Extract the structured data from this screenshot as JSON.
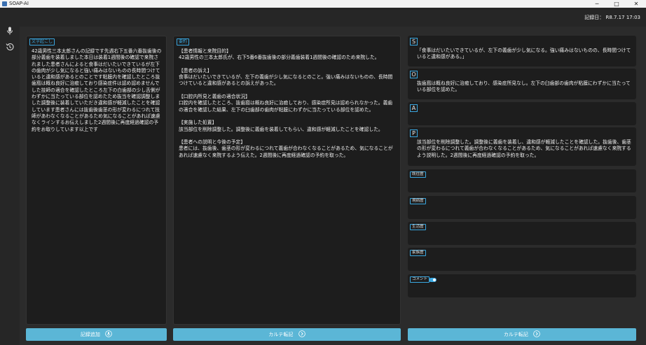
{
  "window": {
    "title": "SOAP-AI",
    "minimize": "─",
    "maximize": "□",
    "close": "✕"
  },
  "header": {
    "record_date": "記録日： R8.7.17 17:03"
  },
  "transcript": {
    "label": "文字起こし",
    "text": "42歳男性三本太郎さんの記録です先週右下五番六番抜歯後の部分義歯を装着しました本日は装着1週間後の確認で来院されました患者さんによると食事はだいたいできているが左下の歯肉が少し気になると強い痛みはないものの長時間つけていると違和感があるとのことです粘膜内を確認したところ抜歯窩は概ね良好に治癒しており感染症件は認め認めませんでした技師の適合を確認したところ左下の白歯部の少し舌側がわずかに当たっている部位を認めたため抜当を確認調整しました調整後に装着していただき違和感が軽減したことを確認しています患者さんには抜歯後歯茎の形が変わるにつれて技師があわなくなることがあるため気になることがあれば速慮なくラインするお伝えしました2週間後に再度経過確認の予約をお取りしています以上です"
  },
  "summary": {
    "label": "要約",
    "text": "【患者情報と来院目的】\n42歳男性の三本太郎氏が、右下5番6番抜歯後の部分義歯装着1週間後の確認のため来院した。\n\n【患者の訴え】\n食事はだいたいできているが、左下の義歯が少し気になるとのこと。強い痛みはないものの、長時間つけていると違和感があるとの訴えがあった。\n\n【口腔内所見と義歯の適合状況】\n口腔内を確認したところ、抜歯窩は概ね良好に治癒しており、感染症所見は認められなかった。義歯の適合を確認した結果、左下の臼歯部の歯肉が粘膜にわずかに当たっている部位を認めた。\n\n【実施した処置】\n該当部位を削除調整した。調整後に義歯を装着してもらい、違和感が軽減したことを確認した。\n\n【患者への説明と今後の予定】\n患者には、抜歯後、歯茎の形が変わるにつれて義歯が合わなくなることがあるため、気になることがあれば速慮なく来院するよう伝えた。2週間後に再度経過確認の予約を取った。"
  },
  "soap": {
    "s": {
      "letter": "S",
      "text": "「食事はだいたいできているが、左下の義歯が少し気になる。強い痛みはないものの、長時間つけていると違和感がある。」"
    },
    "o": {
      "letter": "O",
      "text": "抜歯窩は概ね良好に治癒しており、感染症所見なし。左下の臼歯部の歯肉が粘膜にわずかに当たっている部位を認めた。"
    },
    "a": {
      "letter": "A",
      "text": ""
    },
    "p": {
      "letter": "P",
      "text": "該当部位を削除調整した。調整後に義歯を装着し、違和感が軽減したことを確認した。抜歯後、歯茎の形が変わるにつれて義歯が合わなくなることがあるため、気になることがあれば速慮なく来院するよう説明した。2週間後に再度経過確認の予約を取った。"
    }
  },
  "history": {
    "past_history": "既往歴",
    "present_illness": "現病歴",
    "lifestyle": "生活歴",
    "family_history": "家族歴",
    "comment": "コメント",
    "comment_toggle_on": true
  },
  "buttons": {
    "add_record": "記録追加",
    "chart_transfer_1": "カルテ転記",
    "chart_transfer_2": "カルテ転記"
  },
  "icons": {
    "sidebar_top": "microphone-icon",
    "sidebar_second": "history-icon",
    "add_record": "microphone-circle-icon",
    "chart_transfer": "arrow-circle-icon"
  },
  "colors": {
    "accent": "#3aa7e0",
    "button": "#5bb6d6",
    "panel_bg": "#1d1d1d",
    "app_bg": "#2b2b2b"
  }
}
